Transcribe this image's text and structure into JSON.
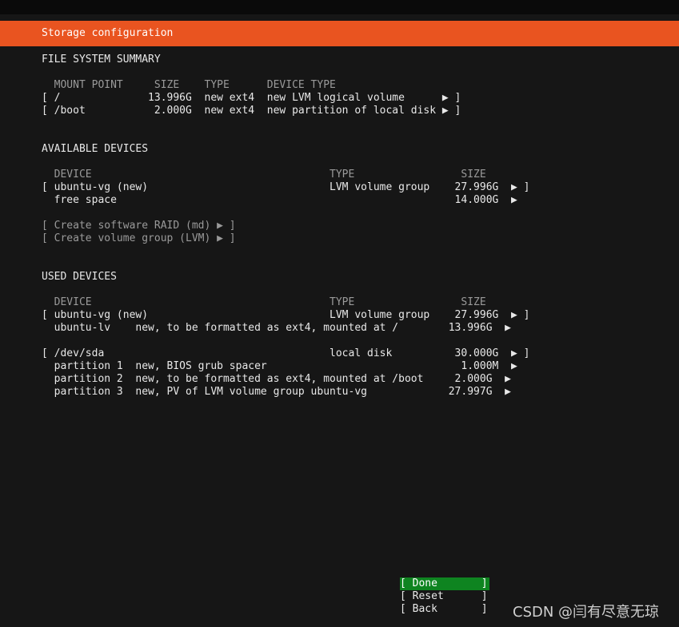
{
  "header": {
    "title": "Storage configuration"
  },
  "fs_summary": {
    "heading": "FILE SYSTEM SUMMARY",
    "columns": "  MOUNT POINT     SIZE    TYPE      DEVICE TYPE",
    "rows": [
      "[ /              13.996G  new ext4  new LVM logical volume      ▶ ]",
      "[ /boot           2.000G  new ext4  new partition of local disk ▶ ]"
    ]
  },
  "available": {
    "heading": "AVAILABLE DEVICES",
    "columns": "  DEVICE                                      TYPE                 SIZE",
    "rows": [
      "[ ubuntu-vg (new)                             LVM volume group    27.996G  ▶ ]",
      "  free space                                                      14.000G  ▶"
    ],
    "actions": [
      "[ Create software RAID (md) ▶ ]",
      "[ Create volume group (LVM) ▶ ]"
    ]
  },
  "used": {
    "heading": "USED DEVICES",
    "columns": "  DEVICE                                      TYPE                 SIZE",
    "rows": [
      "[ ubuntu-vg (new)                             LVM volume group    27.996G  ▶ ]",
      "  ubuntu-lv    new, to be formatted as ext4, mounted at /        13.996G  ▶",
      "[ /dev/sda                                    local disk          30.000G  ▶ ]",
      "  partition 1  new, BIOS grub spacer                               1.000M  ▶",
      "  partition 2  new, to be formatted as ext4, mounted at /boot     2.000G  ▶",
      "  partition 3  new, PV of LVM volume group ubuntu-vg             27.997G  ▶"
    ]
  },
  "buttons": {
    "done": "[ Done       ]",
    "reset": "[ Reset      ]",
    "back": "[ Back       ]"
  },
  "colors": {
    "accent": "#e95420",
    "focus": "#0e8420",
    "background": "#161616"
  },
  "watermark": "CSDN @闫有尽意无琼"
}
